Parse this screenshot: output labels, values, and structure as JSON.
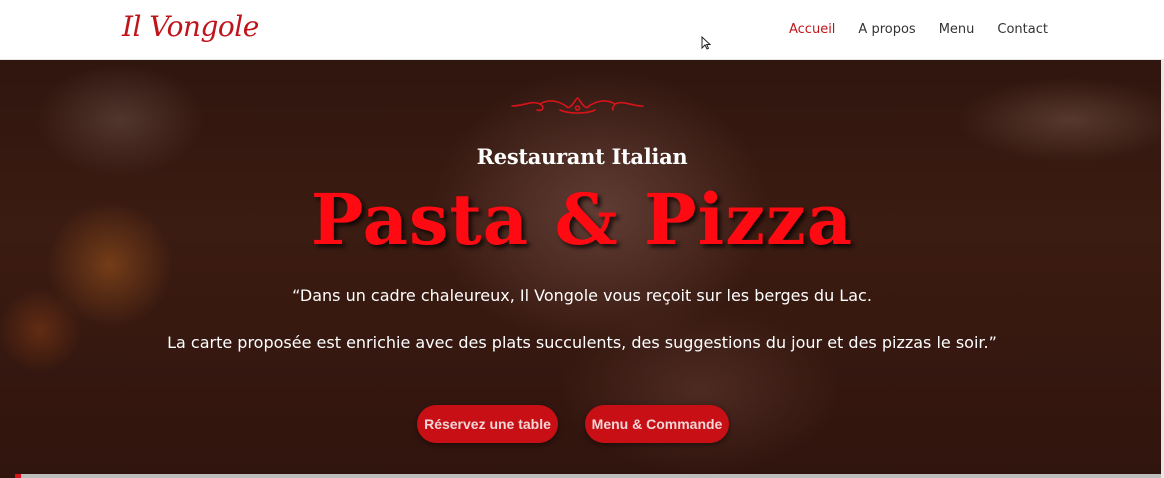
{
  "brand": {
    "logo_text": "Il Vongole",
    "accent_color": "#c0141b"
  },
  "nav": {
    "items": [
      {
        "label": "Accueil",
        "active": true
      },
      {
        "label": "A propos",
        "active": false
      },
      {
        "label": "Menu",
        "active": false
      },
      {
        "label": "Contact",
        "active": false
      }
    ]
  },
  "hero": {
    "ornament_icon": "swirl-ornament-icon",
    "subtitle": "Restaurant Italian",
    "headline": "Pasta & Pizza",
    "headline_color": "#ff0a12",
    "description_line1": "“Dans un cadre chaleureux, Il Vongole vous reçoit sur les berges du Lac.",
    "description_line2": "La carte proposée est enrichie avec des plats succulents, des suggestions du jour et des pizzas le soir.”",
    "buttons": {
      "reserve_label": "Réservez une table",
      "menu_label": "Menu & Commande"
    },
    "button_color": "#c80f16",
    "video_progress": 0.005
  }
}
